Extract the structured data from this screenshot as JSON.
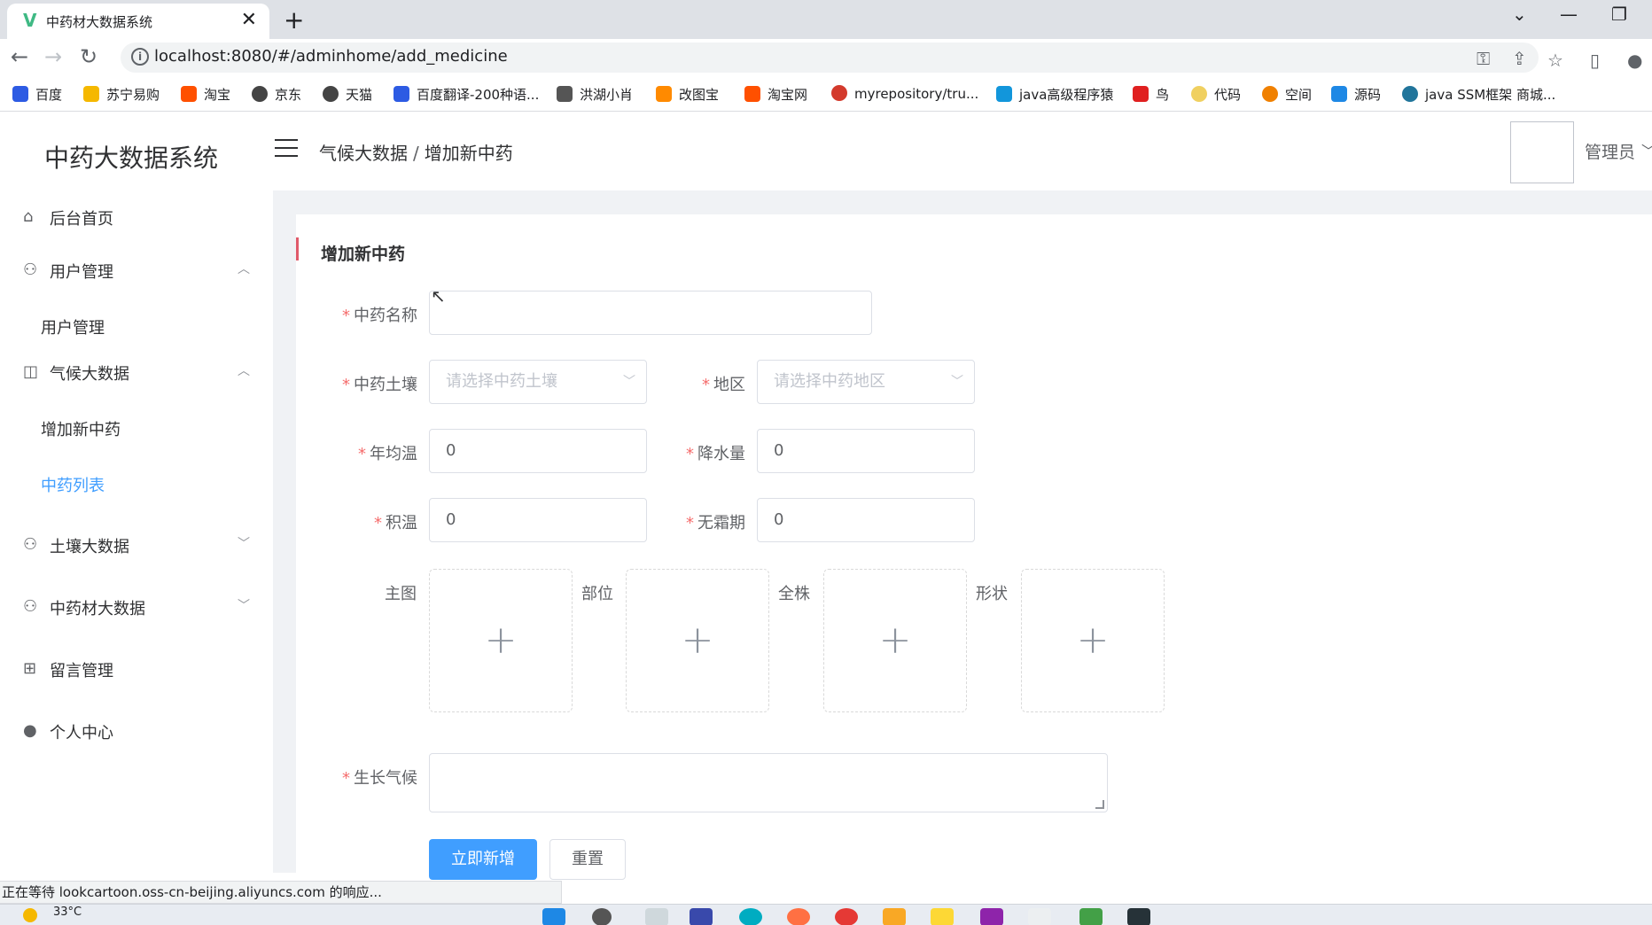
{
  "browser": {
    "tab_title": "中药材大数据系统",
    "tab_close": "✕",
    "new_tab": "+",
    "url": "localhost:8080/#/adminhome/add_medicine",
    "bookmarks": [
      {
        "label": "百度",
        "color": "#2d5be3"
      },
      {
        "label": "苏宁易购",
        "color": "#f5b800"
      },
      {
        "label": "淘宝",
        "color": "#ff5000"
      },
      {
        "label": "京东",
        "color": "#444444"
      },
      {
        "label": "天猫",
        "color": "#444444"
      },
      {
        "label": "百度翻译-200种语...",
        "color": "#2d5be3"
      },
      {
        "label": "洪湖小肖",
        "color": "#555555"
      },
      {
        "label": "改图宝",
        "color": "#ff8a00"
      },
      {
        "label": "淘宝网",
        "color": "#ff5000"
      },
      {
        "label": "myrepository/tru...",
        "color": "#d33a2c"
      },
      {
        "label": "java高级程序猿",
        "color": "#1296db"
      },
      {
        "label": "鸟",
        "color": "#e02020"
      },
      {
        "label": "代码",
        "color": "#f0d060"
      },
      {
        "label": "空间",
        "color": "#f08000"
      },
      {
        "label": "源码",
        "color": "#1e88e5"
      },
      {
        "label": "java SSM框架 商城...",
        "color": "#21759b"
      }
    ]
  },
  "header": {
    "app_title": "中药大数据系统",
    "breadcrumb": [
      "气候大数据",
      "增加新中药"
    ],
    "breadcrumb_sep": "/",
    "user_name": "管理员"
  },
  "sidebar": {
    "items": [
      {
        "label": "后台首页",
        "icon": "home-icon"
      },
      {
        "label": "用户管理",
        "icon": "user-icon",
        "arrow": "︿"
      },
      {
        "label": "用户管理",
        "sub": true
      },
      {
        "label": "气候大数据",
        "icon": "bag-icon",
        "arrow": "︿"
      },
      {
        "label": "增加新中药",
        "sub": true
      },
      {
        "label": "中药列表",
        "sub": true,
        "active": true
      },
      {
        "label": "土壤大数据",
        "icon": "user-icon",
        "arrow": "﹀"
      },
      {
        "label": "中药材大数据",
        "icon": "user-icon",
        "arrow": "﹀"
      },
      {
        "label": "留言管理",
        "icon": "gift-icon"
      },
      {
        "label": "个人中心",
        "icon": "person-icon"
      }
    ]
  },
  "form": {
    "title": "增加新中药",
    "required_mark": "*",
    "name_label": "中药名称",
    "name_value": "",
    "soil_label": "中药土壤",
    "soil_placeholder": "请选择中药土壤",
    "region_label": "地区",
    "region_placeholder": "请选择中药地区",
    "temp_label": "年均温",
    "temp_value": "0",
    "rain_label": "降水量",
    "rain_value": "0",
    "acc_temp_label": "积温",
    "acc_temp_value": "0",
    "frost_free_label": "无霜期",
    "frost_free_value": "0",
    "image_labels": [
      "主图",
      "部位",
      "全株",
      "形状"
    ],
    "plus": "+",
    "climate_label": "生长气候",
    "climate_value": "",
    "submit_label": "立即新增",
    "reset_label": "重置"
  },
  "status_bar": "正在等待 lookcartoon.oss-cn-beijing.aliyuncs.com 的响应...",
  "taskbar": {
    "temperature": "33°C"
  },
  "colors": {
    "primary": "#409eff",
    "required": "#f56c6c",
    "accent_bar": "#e05a6a"
  }
}
